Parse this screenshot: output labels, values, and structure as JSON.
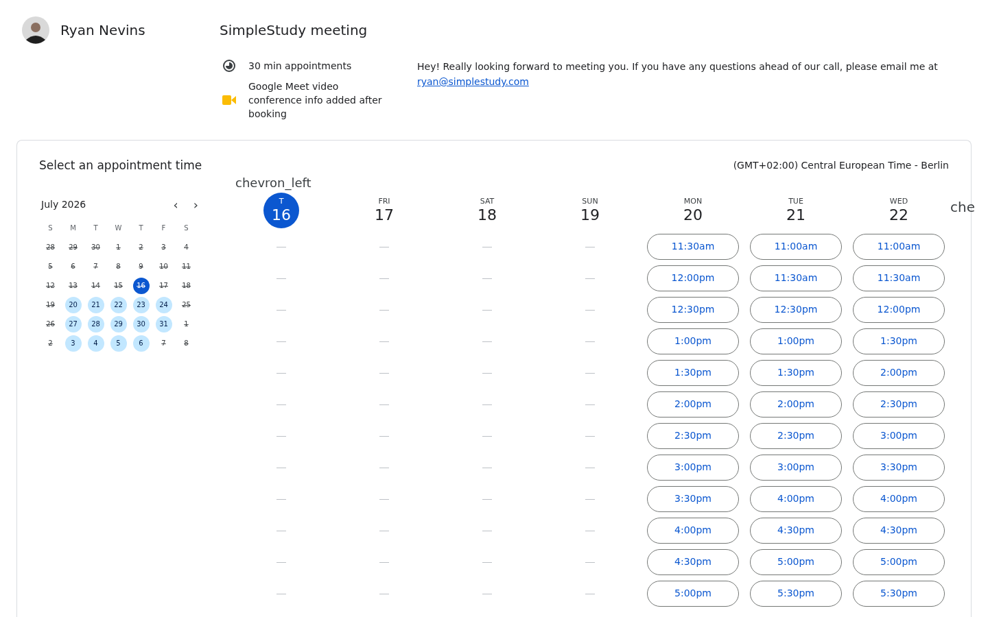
{
  "host": {
    "name": "Ryan Nevins"
  },
  "event": {
    "title": "SimpleStudy meeting",
    "duration": "30 min appointments",
    "conference": "Google Meet video conference info added after booking",
    "description_prefix": "Hey!  Really looking forward to meeting you. If you have any questions ahead of our call, please email me at",
    "email": "ryan@simplestudy.com"
  },
  "booking": {
    "heading": "Select an appointment time",
    "timezone": "(GMT+02:00) Central European Time - Berlin",
    "mini_calendar": {
      "month": "July 2026",
      "prev": "‹",
      "next": "›",
      "weekdays": [
        "S",
        "M",
        "T",
        "W",
        "T",
        "F",
        "S"
      ],
      "weeks": [
        [
          {
            "day": "28",
            "available": false,
            "selected": false
          },
          {
            "day": "29",
            "available": false,
            "selected": false
          },
          {
            "day": "30",
            "available": false,
            "selected": false
          },
          {
            "day": "1",
            "available": false,
            "selected": false
          },
          {
            "day": "2",
            "available": false,
            "selected": false
          },
          {
            "day": "3",
            "available": false,
            "selected": false
          },
          {
            "day": "4",
            "available": false,
            "selected": false
          }
        ],
        [
          {
            "day": "5",
            "available": false,
            "selected": false
          },
          {
            "day": "6",
            "available": false,
            "selected": false
          },
          {
            "day": "7",
            "available": false,
            "selected": false
          },
          {
            "day": "8",
            "available": false,
            "selected": false
          },
          {
            "day": "9",
            "available": false,
            "selected": false
          },
          {
            "day": "10",
            "available": false,
            "selected": false
          },
          {
            "day": "11",
            "available": false,
            "selected": false
          }
        ],
        [
          {
            "day": "12",
            "available": false,
            "selected": false
          },
          {
            "day": "13",
            "available": false,
            "selected": false
          },
          {
            "day": "14",
            "available": false,
            "selected": false
          },
          {
            "day": "15",
            "available": false,
            "selected": false
          },
          {
            "day": "16",
            "available": false,
            "selected": true
          },
          {
            "day": "17",
            "available": false,
            "selected": false
          },
          {
            "day": "18",
            "available": false,
            "selected": false
          }
        ],
        [
          {
            "day": "19",
            "available": false,
            "selected": false
          },
          {
            "day": "20",
            "available": true,
            "selected": false
          },
          {
            "day": "21",
            "available": true,
            "selected": false
          },
          {
            "day": "22",
            "available": true,
            "selected": false
          },
          {
            "day": "23",
            "available": true,
            "selected": false
          },
          {
            "day": "24",
            "available": true,
            "selected": false
          },
          {
            "day": "25",
            "available": false,
            "selected": false
          }
        ],
        [
          {
            "day": "26",
            "available": false,
            "selected": false
          },
          {
            "day": "27",
            "available": true,
            "selected": false
          },
          {
            "day": "28",
            "available": true,
            "selected": false
          },
          {
            "day": "29",
            "available": true,
            "selected": false
          },
          {
            "day": "30",
            "available": true,
            "selected": false
          },
          {
            "day": "31",
            "available": true,
            "selected": false
          },
          {
            "day": "1",
            "available": false,
            "selected": false
          }
        ],
        [
          {
            "day": "2",
            "available": false,
            "selected": false
          },
          {
            "day": "3",
            "available": true,
            "selected": false
          },
          {
            "day": "4",
            "available": true,
            "selected": false
          },
          {
            "day": "5",
            "available": true,
            "selected": false
          },
          {
            "day": "6",
            "available": true,
            "selected": false
          },
          {
            "day": "7",
            "available": false,
            "selected": false
          },
          {
            "day": "8",
            "available": false,
            "selected": false
          }
        ]
      ]
    },
    "prev_week": "chevron_left",
    "next_week": "che",
    "days": [
      {
        "label": "T",
        "date": "16",
        "selected": true,
        "available": false
      },
      {
        "label": "FRI",
        "date": "17",
        "selected": false,
        "available": false
      },
      {
        "label": "SAT",
        "date": "18",
        "selected": false,
        "available": false
      },
      {
        "label": "SUN",
        "date": "19",
        "selected": false,
        "available": false
      },
      {
        "label": "MON",
        "date": "20",
        "selected": false,
        "available": true,
        "slots": [
          "11:30am",
          "12:00pm",
          "12:30pm",
          "1:00pm",
          "1:30pm",
          "2:00pm",
          "2:30pm",
          "3:00pm",
          "3:30pm",
          "4:00pm",
          "4:30pm",
          "5:00pm"
        ]
      },
      {
        "label": "TUE",
        "date": "21",
        "selected": false,
        "available": true,
        "slots": [
          "11:00am",
          "11:30am",
          "12:30pm",
          "1:00pm",
          "1:30pm",
          "2:00pm",
          "2:30pm",
          "3:00pm",
          "4:00pm",
          "4:30pm",
          "5:00pm",
          "5:30pm"
        ]
      },
      {
        "label": "WED",
        "date": "22",
        "selected": false,
        "available": true,
        "slots": [
          "11:00am",
          "11:30am",
          "12:00pm",
          "1:30pm",
          "2:00pm",
          "2:30pm",
          "3:00pm",
          "3:30pm",
          "4:00pm",
          "4:30pm",
          "5:00pm",
          "5:30pm"
        ]
      }
    ]
  }
}
